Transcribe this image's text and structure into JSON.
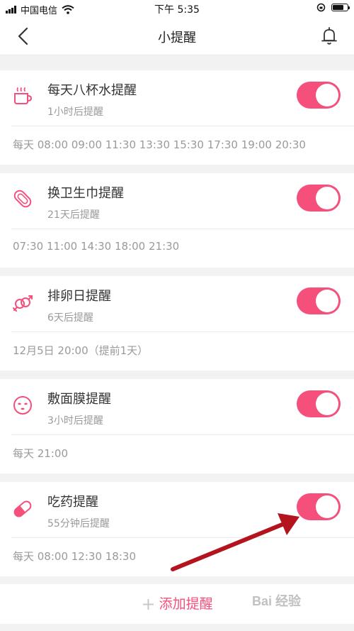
{
  "status_bar": {
    "carrier": "中国电信",
    "time": "下午 5:35"
  },
  "nav": {
    "title": "小提醒"
  },
  "reminders": [
    {
      "icon": "cup-icon",
      "name": "每天八杯水提醒",
      "sub": "1小时后提醒",
      "times": "每天 08:00 09:00 11:30 13:30 15:30 17:30 19:00 20:30",
      "enabled": true
    },
    {
      "icon": "pad-icon",
      "name": "换卫生巾提醒",
      "sub": "21天后提醒",
      "times": "07:30 11:00 14:30 18:00 21:30",
      "enabled": true
    },
    {
      "icon": "gender-rings-icon",
      "name": "排卵日提醒",
      "sub": "6天后提醒",
      "times": "12月5日 20:00（提前1天）",
      "enabled": true
    },
    {
      "icon": "face-mask-icon",
      "name": "敷面膜提醒",
      "sub": "3小时后提醒",
      "times": "每天 21:00",
      "enabled": true
    },
    {
      "icon": "pill-icon",
      "name": "吃药提醒",
      "sub": "55分钟后提醒",
      "times": "每天 08:00 12:30 18:30",
      "enabled": true
    }
  ],
  "add_button": {
    "plus": "+",
    "label": "添加提醒"
  },
  "watermark": "Bai 经验",
  "colors": {
    "accent": "#f5507c",
    "arrow": "#b4141e"
  }
}
